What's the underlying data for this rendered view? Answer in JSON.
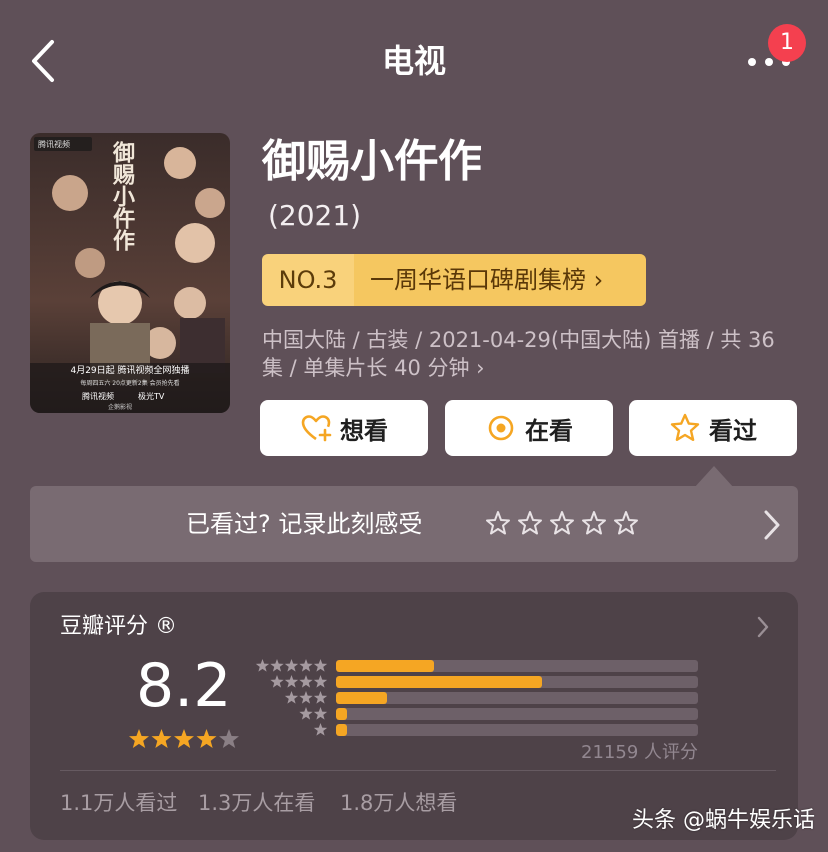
{
  "header": {
    "title": "电视",
    "notification_count": "1",
    "back_icon": "chevron-left-icon",
    "more_icon": "more-icon"
  },
  "movie": {
    "title": "御赐小仵作",
    "year": "(2021)",
    "rank": {
      "number": "NO.3",
      "label": "一周华语口碑剧集榜 ›"
    },
    "meta_line": "中国大陆 / 古装 / 2021-04-29(中国大陆) 首播 / 共 36 集 / 单集片长 40 分钟 ›",
    "poster": {
      "title_text": "御赐小仵作",
      "release_note": "4月29日起 腾讯视频全网独播",
      "schedule_note": "每周四五六 20点更新2集 会员抢先看",
      "platform_1": "腾讯视频",
      "platform_2": "极光TV",
      "platform_3": "企鹅影视",
      "corner_logo": "腾讯视频"
    }
  },
  "actions": [
    {
      "label": "想看",
      "icon": "heart-plus-icon"
    },
    {
      "label": "在看",
      "icon": "target-icon"
    },
    {
      "label": "看过",
      "icon": "star-outline-icon"
    }
  ],
  "record": {
    "prompt": "已看过? 记录此刻感受"
  },
  "rating": {
    "title": "豆瓣评分 ®",
    "score": "8.2",
    "star_rating": 4,
    "count_text": "21159 人评分",
    "distribution": [
      {
        "stars": 5,
        "fraction": 0.27
      },
      {
        "stars": 4,
        "fraction": 0.57
      },
      {
        "stars": 3,
        "fraction": 0.14
      },
      {
        "stars": 2,
        "fraction": 0.03
      },
      {
        "stars": 1,
        "fraction": 0.03
      }
    ],
    "stats": [
      "1.1万人看过",
      "1.3万人在看",
      "1.8万人想看"
    ]
  },
  "watermark": "头条 @蜗牛娱乐话",
  "colors": {
    "background": "#5f5058",
    "rank_gold": "#f5c760",
    "star_orange": "#f5a623",
    "badge_red": "#f4404f",
    "button_accent": "#f5a623"
  }
}
